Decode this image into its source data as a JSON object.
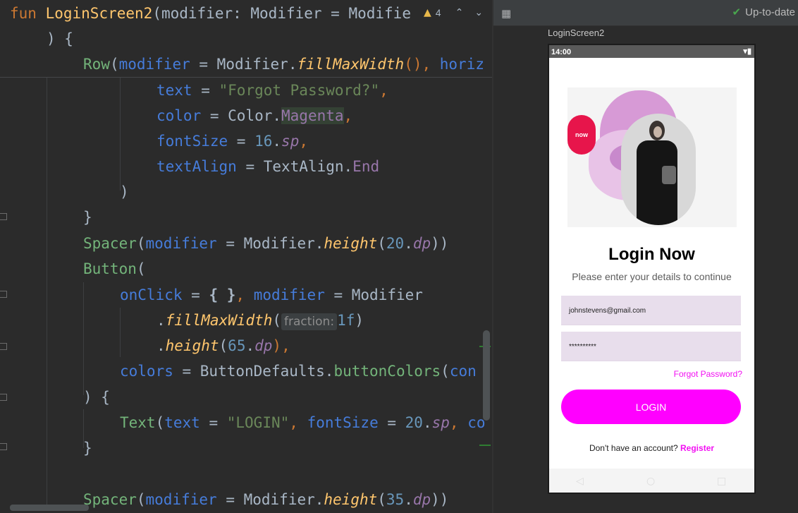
{
  "editor": {
    "warning_count": "4",
    "hint_fraction": "fraction:",
    "lines": {
      "l1": [
        "fun",
        "LoginScreen2",
        "(modifier: Modifier = Modifie"
      ],
      "l2": ") {",
      "l3": [
        "Row",
        "(",
        "modifier",
        " = Modifier.",
        "fillMaxWidth",
        "(),",
        " horiz"
      ],
      "l4": [
        "text",
        " = ",
        "\"Forgot Password?\"",
        ","
      ],
      "l5": [
        "color",
        " = Color.",
        "Magenta",
        ","
      ],
      "l6": [
        "fontSize",
        " = ",
        "16",
        ".",
        "sp",
        ","
      ],
      "l7": [
        "textAlign",
        " = TextAlign.",
        "End"
      ],
      "l8": ")",
      "l9": "}",
      "l10": [
        "Spacer",
        "(",
        "modifier",
        " = Modifier.",
        "height",
        "(",
        "20",
        ".",
        "dp",
        "))"
      ],
      "l11": [
        "Button",
        "("
      ],
      "l12": [
        "onClick",
        " = ",
        "{ }",
        ",",
        " modifier",
        " = Modifier"
      ],
      "l13": [
        ".",
        "fillMaxWidth",
        "(",
        "1f",
        ")"
      ],
      "l14": [
        ".",
        "height",
        "(",
        "65",
        ".",
        "dp",
        "),"
      ],
      "l15": [
        "colors",
        " = ButtonDefaults.",
        "buttonColors",
        "(",
        "con"
      ],
      "l16": ") {",
      "l17": [
        "Text",
        "(",
        "text",
        " = ",
        "\"LOGIN\"",
        ",",
        " fontSize",
        " = ",
        "20",
        ".",
        "sp",
        ",",
        " co"
      ],
      "l18": "}",
      "l19": [
        "Spacer",
        "(",
        "modifier",
        " = Modifier.",
        "height",
        "(",
        "35",
        ".",
        "dp",
        "))"
      ]
    }
  },
  "preview": {
    "status": "Up-to-date",
    "composable_name": "LoginScreen2",
    "phone": {
      "time": "14:00",
      "status_icons": "▾▮",
      "badge_text": "now",
      "title": "Login Now",
      "subtitle": "Please enter your details to continue",
      "email_value": "johnstevens@gmail.com",
      "password_value": "**********",
      "forgot": "Forgot Password?",
      "login_button": "LOGIN",
      "signup_text": "Don't have an account?",
      "register_link": "Register"
    }
  }
}
